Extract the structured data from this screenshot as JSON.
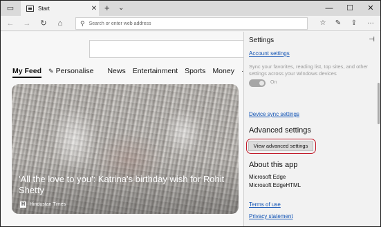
{
  "tabbar": {
    "tab_title": "Start",
    "close_glyph": "✕",
    "add_glyph": "+",
    "menu_glyph": "⌄",
    "minimize_glyph": "—",
    "maximize_glyph": "☐",
    "close_window_glyph": "✕"
  },
  "navbar": {
    "address_placeholder": "Search or enter web address"
  },
  "page": {
    "feed_items": [
      "My Feed",
      "Personalise",
      "News",
      "Entertainment",
      "Sports",
      "Money"
    ],
    "more_glyph": "···",
    "card": {
      "headline": "'All the love to you': Katrina's birthday wish for Rohit Shetty",
      "source": "Hindustan Times"
    }
  },
  "settings": {
    "title": "Settings",
    "account_settings": "Account settings",
    "sync_description": "Sync your favorites, reading list, top sites, and other settings across your Windows devices",
    "toggle_label": "On",
    "toggle_state": "on",
    "device_sync": "Device sync settings",
    "advanced_heading": "Advanced settings",
    "advanced_button": "View advanced settings",
    "about_heading": "About this app",
    "about_line1": "Microsoft Edge",
    "about_line2": "Microsoft EdgeHTML",
    "terms": "Terms of use",
    "privacy": "Privacy statement"
  },
  "colors": {
    "link": "#0b4fb3",
    "highlight": "#c21b2a"
  }
}
